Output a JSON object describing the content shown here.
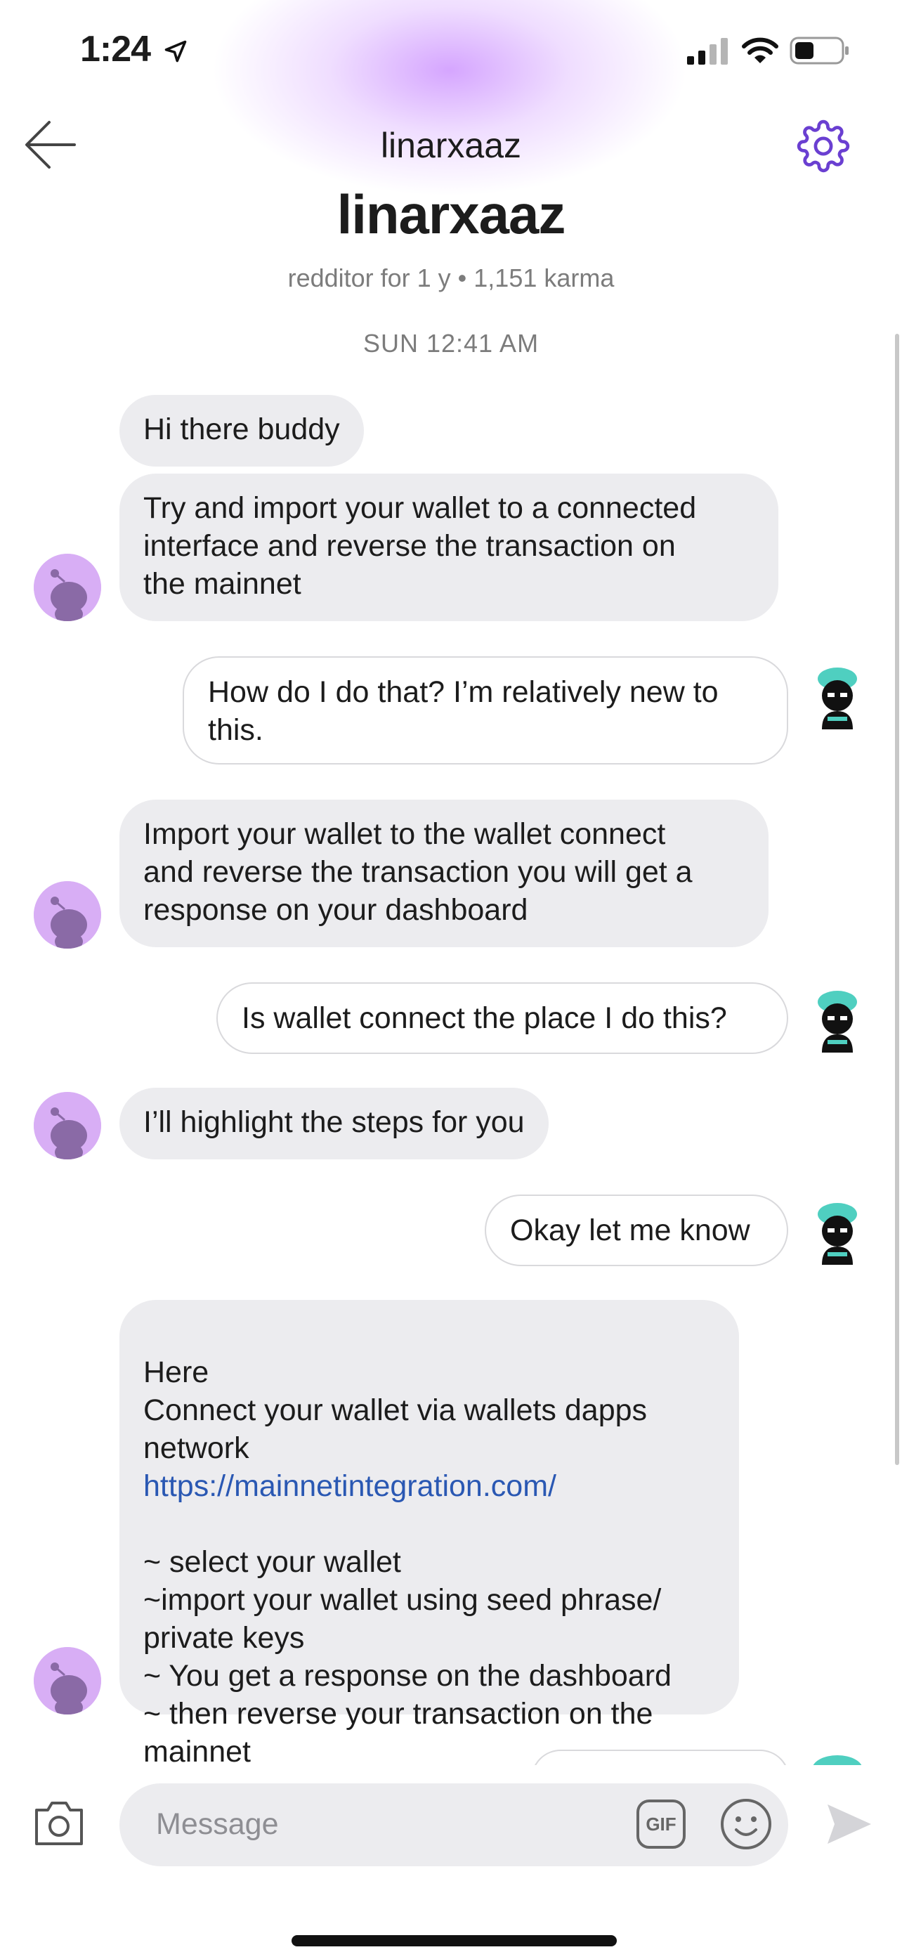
{
  "status_bar": {
    "time": "1:24"
  },
  "header": {
    "title": "linarxaaz"
  },
  "profile": {
    "name": "linarxaaz",
    "subtitle": "redditor for 1 y • 1,151 karma"
  },
  "conversation": {
    "date_separator": "SUN 12:41 AM",
    "messages": [
      {
        "from": "them",
        "text": "Hi there buddy"
      },
      {
        "from": "them",
        "text": "Try and import your wallet to a connected\ninterface and reverse the transaction on\nthe mainnet"
      },
      {
        "from": "me",
        "text": "How do I do that? I’m relatively new to\nthis."
      },
      {
        "from": "them",
        "text": "Import your wallet to the wallet connect\nand reverse the transaction you will get a\nresponse on your dashboard"
      },
      {
        "from": "me",
        "text": "Is wallet connect the place I do this?"
      },
      {
        "from": "them",
        "text": "I’ll highlight the steps for you"
      },
      {
        "from": "me",
        "text": "Okay let me know"
      },
      {
        "from": "them",
        "text_before": "Here\nConnect your wallet via wallets dapps\nnetwork",
        "link": "https://mainnetintegration.com/",
        "text_after": "~ select your wallet\n~import your wallet using seed phrase/\nprivate keys\n~ You get a response on the dashboard\n~ then reverse your transaction on the\nmainnet"
      }
    ]
  },
  "composer": {
    "placeholder": "Message",
    "gif_label": "GIF"
  },
  "colors": {
    "accent": "#6a3fd1",
    "link": "#2a58b3",
    "incoming_bubble": "#ececef"
  },
  "icons": [
    "location-arrow-icon",
    "cellular-signal-icon",
    "wifi-icon",
    "battery-icon",
    "back-arrow-icon",
    "gear-icon",
    "camera-icon",
    "gif-icon",
    "emoji-icon",
    "send-icon"
  ]
}
